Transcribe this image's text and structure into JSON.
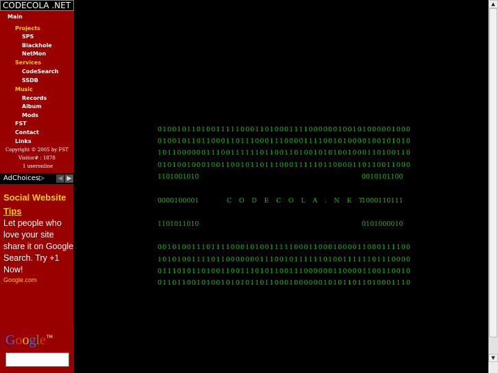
{
  "site_title": "CODECOLA .NET",
  "nav": {
    "main": "Main",
    "projects": "Projects",
    "sps": "SPS",
    "blackhole": "Blackhole",
    "netmon": "NetMon",
    "services": "Services",
    "codesearch": "CodeSearch",
    "ssdb": "SSDB",
    "music": "Music",
    "records": "Records",
    "album": "Album",
    "mods": "Mods",
    "fst": "FST",
    "contact": "Contact",
    "links": "Links"
  },
  "footer": {
    "copyright": "Copyright © 2005 by FST",
    "visitor": "Visitor# : 1878",
    "online": "1 useronline"
  },
  "ad": {
    "ad_choices": "AdChoices",
    "title_line1": "Social Website",
    "title_line2": "Tips",
    "body": "Let people who love your site share it on Google Search. Try +1 Now!",
    "url": "Google.com"
  },
  "google": {
    "logo_letters": [
      "G",
      "o",
      "o",
      "g",
      "l",
      "e"
    ],
    "logo_colors": [
      "#3b6fd4",
      "#d63a2a",
      "#e8b800",
      "#3b6fd4",
      "#2ea84a",
      "#d63a2a"
    ],
    "tm": "TM",
    "search_value": ""
  },
  "binary": {
    "rows_top": [
      "0100101101001111100011010001111000000100101000001000",
      "0100101101100011011100011100001111001010000100101010",
      "1011000000111001111110110011010010101001000110100110",
      "0101001000100110010110111000111110110000110110011000"
    ],
    "row5_left": "1101001010",
    "row5_right": "0010101100",
    "brand_left": "0000100001",
    "brand_text": "C O D E C O L A . N E T",
    "brand_right": "1000110111",
    "row7_left": "1101011010",
    "row7_right": "0101000010",
    "rows_bottom": [
      "0010100111011110001010011111000110001000011000111100",
      "1010100111101100000001110010111111010011111101110000",
      "0111010110100110011101011001110000001100001100110010",
      "0110110010100101010110110001000000101011011010001110"
    ]
  },
  "scrollbar": {
    "up_arrow": "▲",
    "down_arrow": "▼"
  },
  "icons": {
    "ad_choices_icon": "▷",
    "ad_prev": "◀",
    "ad_next": "▶"
  }
}
